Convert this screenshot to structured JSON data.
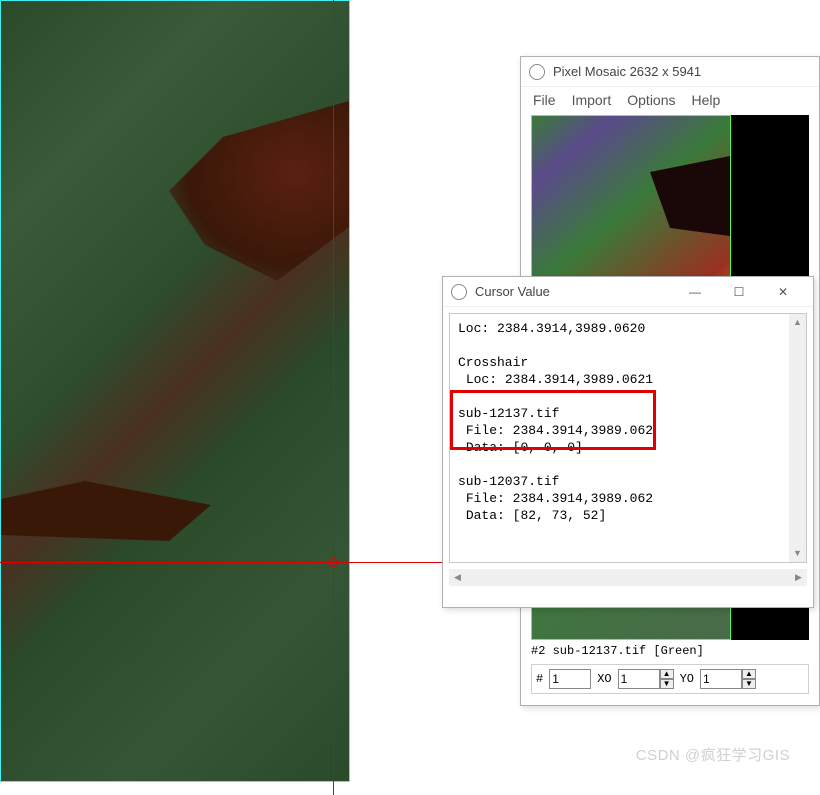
{
  "mosaic_window": {
    "title": "Pixel Mosaic 2632 x 5941",
    "menu": {
      "file": "File",
      "import": "Import",
      "options": "Options",
      "help": "Help"
    },
    "info_line": "#2 sub-12137.tif [Green]",
    "inputs": {
      "hash_label": "#",
      "hash_value": "1",
      "xo_label": "XO",
      "xo_value": "1",
      "yo_label": "YO",
      "yo_value": "1"
    }
  },
  "cursor_window": {
    "title": "Cursor Value",
    "loc_label": "Loc:",
    "loc_value": "2384.3914,3989.0620",
    "crosshair_label": "Crosshair",
    "crosshair_loc_label": "Loc:",
    "crosshair_loc_value": "2384.3914,3989.0621",
    "files": [
      {
        "name": "sub-12137.tif",
        "file_label": "File:",
        "file_value": "2384.3914,3989.062",
        "data_label": "Data:",
        "data_value": "[0, 0, 0]"
      },
      {
        "name": "sub-12037.tif",
        "file_label": "File:",
        "file_value": "2384.3914,3989.062",
        "data_label": "Data:",
        "data_value": "[82, 73, 52]"
      }
    ]
  },
  "watermark": "CSDN @疯狂学习GIS"
}
